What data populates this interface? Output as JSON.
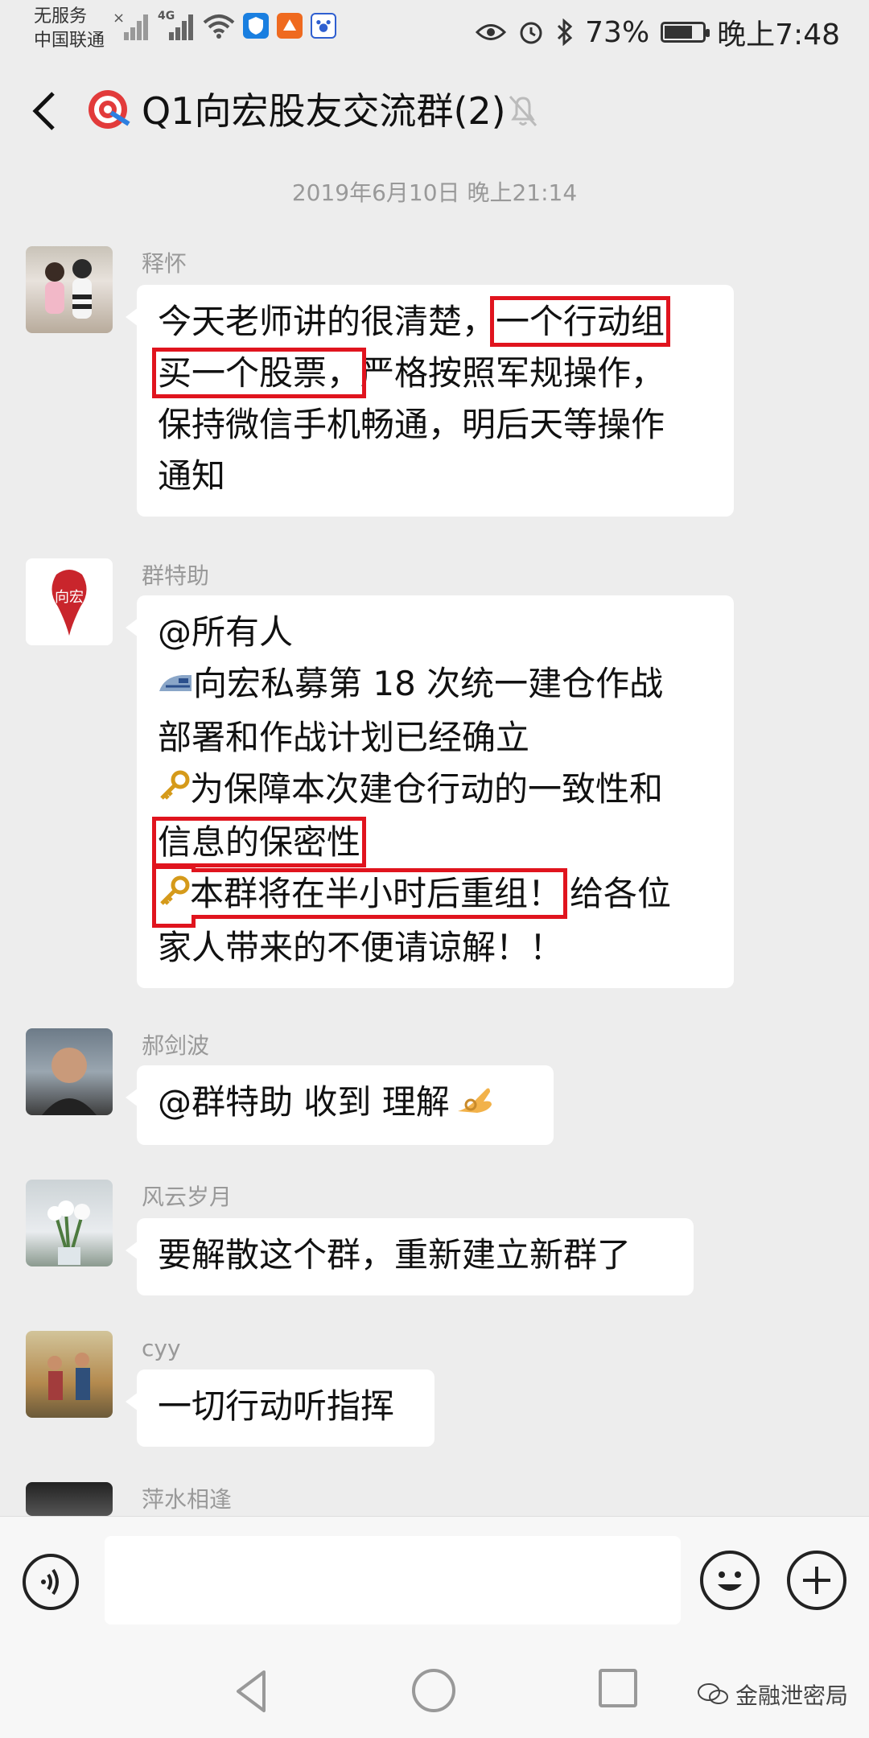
{
  "status_bar": {
    "carrier_line1": "无服务",
    "carrier_line2": "中国联通",
    "network_label": "4G",
    "battery": "73%",
    "battery_level": 0.73,
    "time": "晚上7:48"
  },
  "header": {
    "title": "Q1向宏股友交流群(2)",
    "back_icon": "chevron-left-icon",
    "mute_icon": "bell-off-icon"
  },
  "chat": {
    "timestamp": "2019年6月10日 晚上21:14",
    "messages": [
      {
        "sender": "释怀",
        "lines": [
          {
            "a": "今天老师讲的很清楚，",
            "h": "一个行动组"
          },
          {
            "h": "买一个股票，",
            "b": "严格按照军规操作，"
          },
          {
            "a": "保持微信手机畅通，明后天等操作"
          },
          {
            "a": "通知"
          }
        ]
      },
      {
        "sender": "群特助",
        "avatar_text": "向宏",
        "lines": [
          {
            "a": "@所有人"
          },
          {
            "a": "向宏私募第 18 次统一建仓作战"
          },
          {
            "a": "部署和作战计划已经确立"
          },
          {
            "a": "为保障本次建仓行动的一致性和"
          },
          {
            "h": "信息的保密性"
          },
          {
            "h": "本群将在半小时后重组！",
            "b": "给各位"
          },
          {
            "a": "家人带来的不便请谅解！！"
          }
        ]
      },
      {
        "sender": "郝剑波",
        "text": "@群特助  收到  理解"
      },
      {
        "sender": "风云岁月",
        "text": "要解散这个群，重新建立新群了"
      },
      {
        "sender": "cyy",
        "text": "一切行动听指挥"
      },
      {
        "sender": "萍水相逢"
      }
    ]
  },
  "input": {
    "value": "",
    "placeholder": ""
  },
  "watermark": "金融泄密局"
}
